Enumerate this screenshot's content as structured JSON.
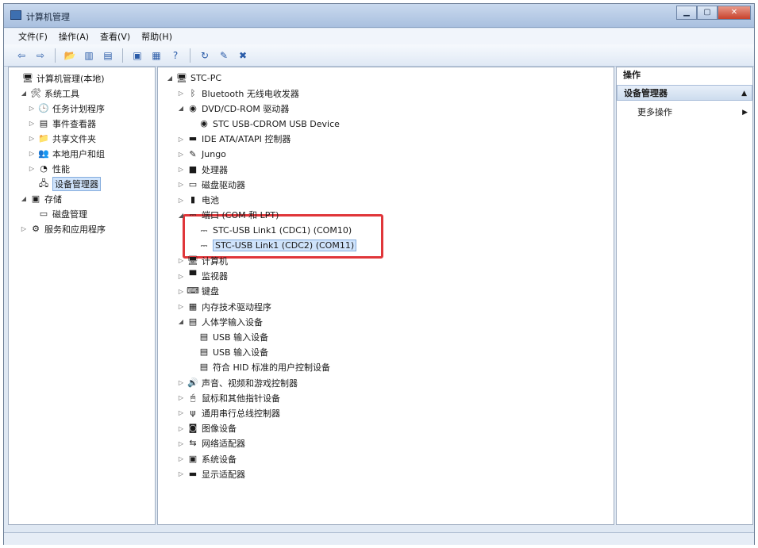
{
  "window": {
    "title": "计算机管理"
  },
  "menubar": [
    "文件(F)",
    "操作(A)",
    "查看(V)",
    "帮助(H)"
  ],
  "left_tree": [
    {
      "label": "计算机管理(本地)",
      "depth": 0,
      "exp": "",
      "icon": "computer-management-icon",
      "glyph": "🖥"
    },
    {
      "label": "系统工具",
      "depth": 1,
      "exp": "◢",
      "icon": "tools-folder-icon",
      "glyph": "🛠"
    },
    {
      "label": "任务计划程序",
      "depth": 2,
      "exp": "▷",
      "icon": "clock-icon",
      "glyph": "🕒"
    },
    {
      "label": "事件查看器",
      "depth": 2,
      "exp": "▷",
      "icon": "event-viewer-icon",
      "glyph": "▤"
    },
    {
      "label": "共享文件夹",
      "depth": 2,
      "exp": "▷",
      "icon": "shared-folder-icon",
      "glyph": "📁"
    },
    {
      "label": "本地用户和组",
      "depth": 2,
      "exp": "▷",
      "icon": "users-icon",
      "glyph": "👥"
    },
    {
      "label": "性能",
      "depth": 2,
      "exp": "▷",
      "icon": "performance-icon",
      "glyph": "◔"
    },
    {
      "label": "设备管理器",
      "depth": 2,
      "exp": "",
      "icon": "device-manager-icon",
      "glyph": "🖧",
      "selected": true
    },
    {
      "label": "存储",
      "depth": 1,
      "exp": "◢",
      "icon": "storage-icon",
      "glyph": "▣"
    },
    {
      "label": "磁盘管理",
      "depth": 2,
      "exp": "",
      "icon": "disk-icon",
      "glyph": "▭"
    },
    {
      "label": "服务和应用程序",
      "depth": 1,
      "exp": "▷",
      "icon": "services-icon",
      "glyph": "⚙"
    }
  ],
  "device_tree": [
    {
      "label": "STC-PC",
      "depth": 0,
      "exp": "◢",
      "icon": "computer-icon",
      "glyph": "🖥"
    },
    {
      "label": "Bluetooth 无线电收发器",
      "depth": 1,
      "exp": "▷",
      "icon": "bluetooth-icon",
      "glyph": "ᛒ"
    },
    {
      "label": "DVD/CD-ROM 驱动器",
      "depth": 1,
      "exp": "◢",
      "icon": "dvd-drive-icon",
      "glyph": "◉"
    },
    {
      "label": "STC USB-CDROM USB Device",
      "depth": 2,
      "exp": "",
      "icon": "cdrom-device-icon",
      "glyph": "◉"
    },
    {
      "label": "IDE ATA/ATAPI 控制器",
      "depth": 1,
      "exp": "▷",
      "icon": "ide-controller-icon",
      "glyph": "▬"
    },
    {
      "label": "Jungo",
      "depth": 1,
      "exp": "▷",
      "icon": "jungo-icon",
      "glyph": "✎"
    },
    {
      "label": "处理器",
      "depth": 1,
      "exp": "▷",
      "icon": "processor-icon",
      "glyph": "■"
    },
    {
      "label": "磁盘驱动器",
      "depth": 1,
      "exp": "▷",
      "icon": "disk-drive-icon",
      "glyph": "▭"
    },
    {
      "label": "电池",
      "depth": 1,
      "exp": "▷",
      "icon": "battery-icon",
      "glyph": "▮"
    },
    {
      "label": "端口 (COM 和 LPT)",
      "depth": 1,
      "exp": "◢",
      "icon": "port-icon",
      "glyph": "⎓"
    },
    {
      "label": "STC-USB Link1 (CDC1) (COM10)",
      "depth": 2,
      "exp": "",
      "icon": "com-port-icon",
      "glyph": "⎓"
    },
    {
      "label": "STC-USB Link1 (CDC2) (COM11)",
      "depth": 2,
      "exp": "",
      "icon": "com-port-icon",
      "glyph": "⎓",
      "selected": true
    },
    {
      "label": "计算机",
      "depth": 1,
      "exp": "▷",
      "icon": "computer-icon",
      "glyph": "🖥"
    },
    {
      "label": "监视器",
      "depth": 1,
      "exp": "▷",
      "icon": "monitor-icon",
      "glyph": "▀"
    },
    {
      "label": "键盘",
      "depth": 1,
      "exp": "▷",
      "icon": "keyboard-icon",
      "glyph": "⌨"
    },
    {
      "label": "内存技术驱动程序",
      "depth": 1,
      "exp": "▷",
      "icon": "memory-icon",
      "glyph": "▦"
    },
    {
      "label": "人体学输入设备",
      "depth": 1,
      "exp": "◢",
      "icon": "hid-icon",
      "glyph": "▤"
    },
    {
      "label": "USB 输入设备",
      "depth": 2,
      "exp": "",
      "icon": "hid-device-icon",
      "glyph": "▤"
    },
    {
      "label": "USB 输入设备",
      "depth": 2,
      "exp": "",
      "icon": "hid-device-icon",
      "glyph": "▤"
    },
    {
      "label": "符合 HID 标准的用户控制设备",
      "depth": 2,
      "exp": "",
      "icon": "hid-device-icon",
      "glyph": "▤"
    },
    {
      "label": "声音、视频和游戏控制器",
      "depth": 1,
      "exp": "▷",
      "icon": "sound-icon",
      "glyph": "🔊"
    },
    {
      "label": "鼠标和其他指针设备",
      "depth": 1,
      "exp": "▷",
      "icon": "mouse-icon",
      "glyph": "🖱"
    },
    {
      "label": "通用串行总线控制器",
      "depth": 1,
      "exp": "▷",
      "icon": "usb-icon",
      "glyph": "ψ"
    },
    {
      "label": "图像设备",
      "depth": 1,
      "exp": "▷",
      "icon": "camera-icon",
      "glyph": "◙"
    },
    {
      "label": "网络适配器",
      "depth": 1,
      "exp": "▷",
      "icon": "network-adapter-icon",
      "glyph": "⇆"
    },
    {
      "label": "系统设备",
      "depth": 1,
      "exp": "▷",
      "icon": "system-device-icon",
      "glyph": "▣"
    },
    {
      "label": "显示适配器",
      "depth": 1,
      "exp": "▷",
      "icon": "display-adapter-icon",
      "glyph": "▬"
    }
  ],
  "actions": {
    "header": "操作",
    "group": "设备管理器",
    "item": "更多操作"
  },
  "colors": {
    "highlight_box": "#e0363a",
    "selection": "#cfe3fb"
  }
}
